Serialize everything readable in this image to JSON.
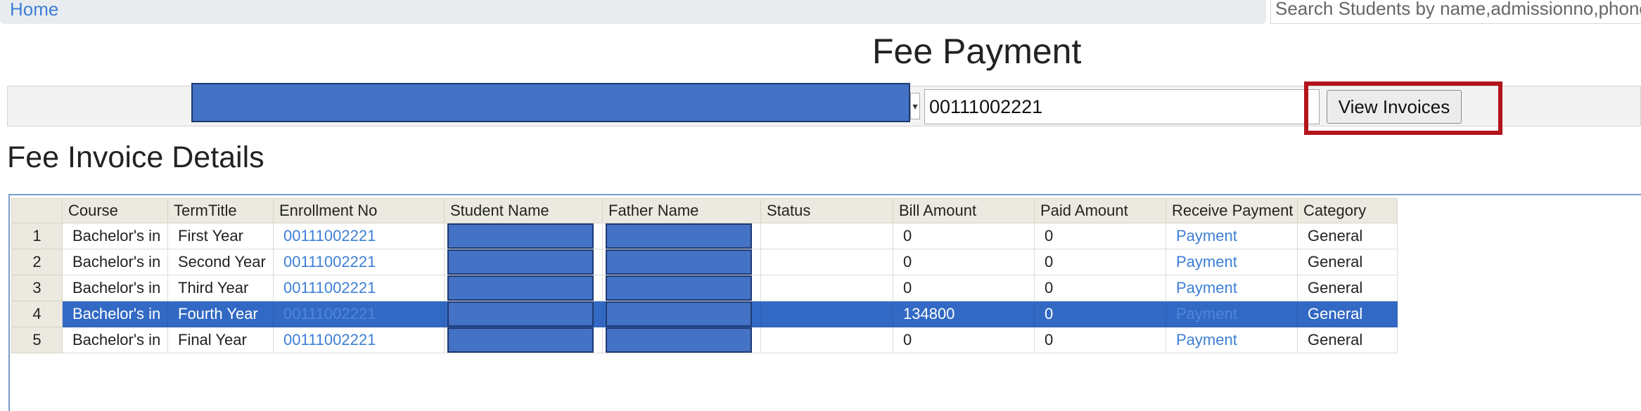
{
  "nav": {
    "home_label": "Home"
  },
  "search": {
    "placeholder": "Search Students by name,admissionno,phone"
  },
  "page": {
    "title": "Fee Payment"
  },
  "filters": {
    "enrollment_value": "00111002221",
    "view_button_label": "View Invoices"
  },
  "section": {
    "title": "Fee Invoice Details"
  },
  "colors": {
    "redaction": "#4472c4",
    "selected_row": "#3269c4",
    "highlight": "#b3141c",
    "link": "#3d7fd6"
  },
  "table": {
    "headers": [
      "Course",
      "TermTitle",
      "Enrollment No",
      "Student Name",
      "Father Name",
      "Status",
      "Bill Amount",
      "Paid Amount",
      "Receive Payment",
      "Category"
    ],
    "rows": [
      {
        "num": "1",
        "course": "Bachelor's in",
        "term": "First Year",
        "enrollment": "00111002221",
        "status": "",
        "bill": "0",
        "paid": "0",
        "payment": "Payment",
        "category": "General"
      },
      {
        "num": "2",
        "course": "Bachelor's in",
        "term": "Second Year",
        "enrollment": "00111002221",
        "status": "",
        "bill": "0",
        "paid": "0",
        "payment": "Payment",
        "category": "General"
      },
      {
        "num": "3",
        "course": "Bachelor's in",
        "term": "Third Year",
        "enrollment": "00111002221",
        "status": "",
        "bill": "0",
        "paid": "0",
        "payment": "Payment",
        "category": "General"
      },
      {
        "num": "4",
        "course": "Bachelor's in",
        "term": "Fourth Year",
        "enrollment": "00111002221",
        "status": "",
        "bill": "134800",
        "paid": "0",
        "payment": "Payment",
        "category": "General"
      },
      {
        "num": "5",
        "course": "Bachelor's in",
        "term": "Final Year",
        "enrollment": "00111002221",
        "status": "",
        "bill": "0",
        "paid": "0",
        "payment": "Payment",
        "category": "General"
      }
    ]
  }
}
